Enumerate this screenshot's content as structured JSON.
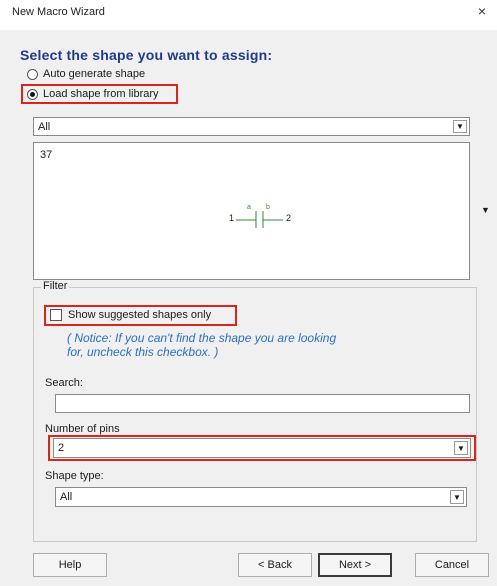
{
  "window": {
    "title": "New Macro Wizard",
    "close_glyph": "×"
  },
  "heading": "Select the shape you want to assign:",
  "options": {
    "auto": {
      "label": "Auto generate shape",
      "selected": false
    },
    "load": {
      "label": "Load shape from library",
      "selected": true
    }
  },
  "library_select": {
    "value": "All",
    "arrow_icon": "chevron-down-icon"
  },
  "preview": {
    "shape_id": "37",
    "pin_left": "1",
    "pin_right": "2",
    "marker_left": "a",
    "marker_right": "b",
    "scroll_icon": "triangle-down-icon"
  },
  "filter": {
    "label": "Filter",
    "show_suggested": {
      "label": "Show suggested shapes only",
      "checked": false
    },
    "notice_line1": "( Notice: If you can't find the shape you are looking",
    "notice_line2": "for, uncheck this checkbox. )",
    "search_label": "Search:",
    "search_value": "",
    "pins_label": "Number of pins",
    "pins_value": "2",
    "shape_type_label": "Shape type:",
    "shape_type_value": "All"
  },
  "buttons": {
    "help": "Help",
    "back": "< Back",
    "next": "Next >",
    "cancel": "Cancel"
  },
  "colors": {
    "highlight": "#d7261e",
    "heading": "#1f3a8a",
    "notice": "#2b6fc2"
  }
}
